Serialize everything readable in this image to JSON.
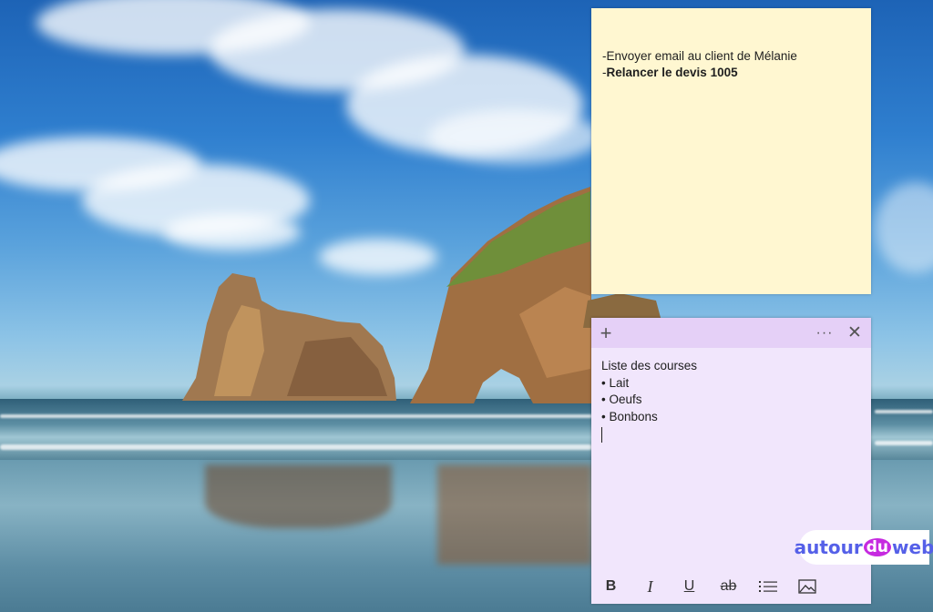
{
  "notes": [
    {
      "color": "#fff7d1",
      "lines": [
        {
          "prefix": "-",
          "text": "Envoyer email au client de Mélanie",
          "bold": false
        },
        {
          "prefix": "-",
          "text": "Relancer le devis 1005",
          "bold": true
        }
      ]
    },
    {
      "color": "#f1e6fc",
      "header_color": "#e5d0f7",
      "title_line": "Liste des courses",
      "bullets": [
        "Lait",
        "Oeufs",
        "Bonbons"
      ],
      "header_buttons": {
        "add": "+",
        "more": "···",
        "close": "✕"
      },
      "toolbar": {
        "bold": "B",
        "italic": "I",
        "underline": "U",
        "strikethrough": "ab"
      }
    }
  ],
  "watermark": {
    "text_before": "autour",
    "text_mid": "du",
    "text_after": "web"
  }
}
